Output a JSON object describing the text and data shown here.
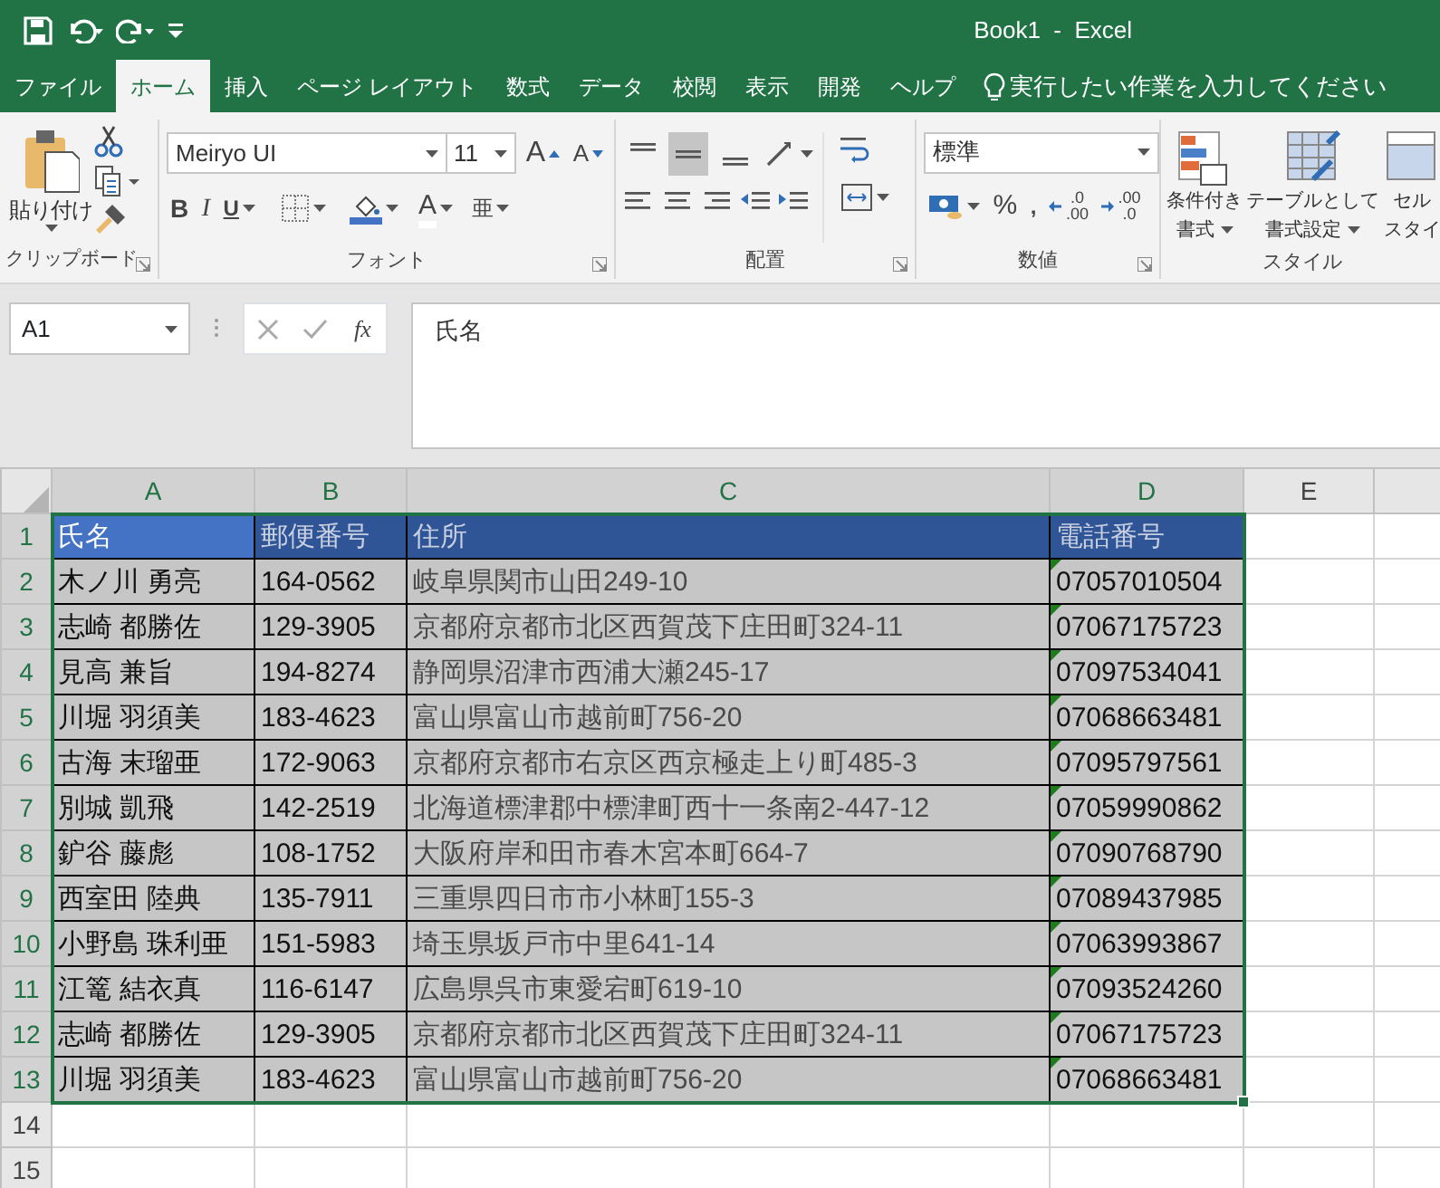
{
  "window": {
    "title": "Book1  -  Excel"
  },
  "tabs": [
    {
      "label": "ファイル",
      "selected": false
    },
    {
      "label": "ホーム",
      "selected": true
    },
    {
      "label": "挿入",
      "selected": false
    },
    {
      "label": "ページ レイアウト",
      "selected": false
    },
    {
      "label": "数式",
      "selected": false
    },
    {
      "label": "データ",
      "selected": false
    },
    {
      "label": "校閲",
      "selected": false
    },
    {
      "label": "表示",
      "selected": false
    },
    {
      "label": "開発",
      "selected": false
    },
    {
      "label": "ヘルプ",
      "selected": false
    }
  ],
  "tell_me": {
    "placeholder": "実行したい作業を入力してください"
  },
  "ribbon": {
    "clipboard": {
      "paste_label": "貼り付け",
      "group_label": "クリップボード"
    },
    "font": {
      "font_name": "Meiryo UI",
      "font_size": "11",
      "grow": "A",
      "shrink": "A",
      "bold": "B",
      "italic": "I",
      "underline": "U",
      "font_color": "A",
      "phonetic": "亜",
      "group_label": "フォント"
    },
    "alignment": {
      "vertical": [
        {
          "kind": "top",
          "selected": false
        },
        {
          "kind": "middle",
          "selected": true
        },
        {
          "kind": "bottom",
          "selected": false
        }
      ],
      "group_label": "配置"
    },
    "number": {
      "format": "標準",
      "percent": "%",
      "comma": ",",
      "increase_decimal": [
        ".0",
        ".00"
      ],
      "decrease_decimal": [
        ".00",
        ".0"
      ],
      "group_label": "数値"
    },
    "styles": {
      "buttons": [
        {
          "kind": "conditional",
          "lines": [
            "条件付き",
            "書式"
          ]
        },
        {
          "kind": "table",
          "lines": [
            "テーブルとして",
            "書式設定"
          ]
        },
        {
          "kind": "cell",
          "lines": [
            "セル",
            "スタイ"
          ]
        }
      ],
      "group_label": "スタイル"
    }
  },
  "formula_bar": {
    "name_box": "A1",
    "fx": "fx",
    "content": "氏名"
  },
  "grid": {
    "columns": [
      {
        "label": "A",
        "selected": true
      },
      {
        "label": "B",
        "selected": true
      },
      {
        "label": "C",
        "selected": true
      },
      {
        "label": "D",
        "selected": true
      },
      {
        "label": "E",
        "selected": false
      }
    ],
    "rows": [
      {
        "number": "1",
        "selected": true,
        "kind": "header",
        "cells": [
          {
            "text": "氏名",
            "active": true
          },
          {
            "text": "郵便番号",
            "active": false
          },
          {
            "text": "住所",
            "active": false
          },
          {
            "text": "電話番号",
            "active": false
          }
        ]
      },
      {
        "number": "2",
        "selected": true,
        "kind": "data",
        "flag": true,
        "cells": [
          "木ノ川 勇亮",
          "164-0562",
          "岐阜県関市山田249-10",
          "07057010504"
        ]
      },
      {
        "number": "3",
        "selected": true,
        "kind": "data",
        "flag": true,
        "cells": [
          "志崎 都勝佐",
          "129-3905",
          "京都府京都市北区西賀茂下庄田町324-11",
          "07067175723"
        ]
      },
      {
        "number": "4",
        "selected": true,
        "kind": "data",
        "flag": true,
        "cells": [
          "見高 兼旨",
          "194-8274",
          "静岡県沼津市西浦大瀬245-17",
          "07097534041"
        ]
      },
      {
        "number": "5",
        "selected": true,
        "kind": "data",
        "flag": true,
        "cells": [
          "川堀 羽須美",
          "183-4623",
          "富山県富山市越前町756-20",
          "07068663481"
        ]
      },
      {
        "number": "6",
        "selected": true,
        "kind": "data",
        "flag": true,
        "cells": [
          "古海 末瑠亜",
          "172-9063",
          "京都府京都市右京区西京極走上り町485-3",
          "07095797561"
        ]
      },
      {
        "number": "7",
        "selected": true,
        "kind": "data",
        "flag": true,
        "cells": [
          "別城 凱飛",
          "142-2519",
          "北海道標津郡中標津町西十一条南2-447-12",
          "07059990862"
        ]
      },
      {
        "number": "8",
        "selected": true,
        "kind": "data",
        "flag": true,
        "cells": [
          "鈩谷 藤彪",
          "108-1752",
          "大阪府岸和田市春木宮本町664-7",
          "07090768790"
        ]
      },
      {
        "number": "9",
        "selected": true,
        "kind": "data",
        "flag": true,
        "cells": [
          "西室田 陸典",
          "135-7911",
          "三重県四日市市小林町155-3",
          "07089437985"
        ]
      },
      {
        "number": "10",
        "selected": true,
        "kind": "data",
        "flag": true,
        "cells": [
          "小野島 珠利亜",
          "151-5983",
          "埼玉県坂戸市中里641-14",
          "07063993867"
        ]
      },
      {
        "number": "11",
        "selected": true,
        "kind": "data",
        "flag": true,
        "cells": [
          "江篭 結衣真",
          "116-6147",
          "広島県呉市東愛宕町619-10",
          "07093524260"
        ]
      },
      {
        "number": "12",
        "selected": true,
        "kind": "data",
        "flag": true,
        "cells": [
          "志崎 都勝佐",
          "129-3905",
          "京都府京都市北区西賀茂下庄田町324-11",
          "07067175723"
        ]
      },
      {
        "number": "13",
        "selected": true,
        "kind": "data",
        "flag": true,
        "cells": [
          "川堀 羽須美",
          "183-4623",
          "富山県富山市越前町756-20",
          "07068663481"
        ]
      },
      {
        "number": "14",
        "selected": false,
        "kind": "empty"
      },
      {
        "number": "15",
        "selected": false,
        "kind": "empty"
      }
    ]
  }
}
